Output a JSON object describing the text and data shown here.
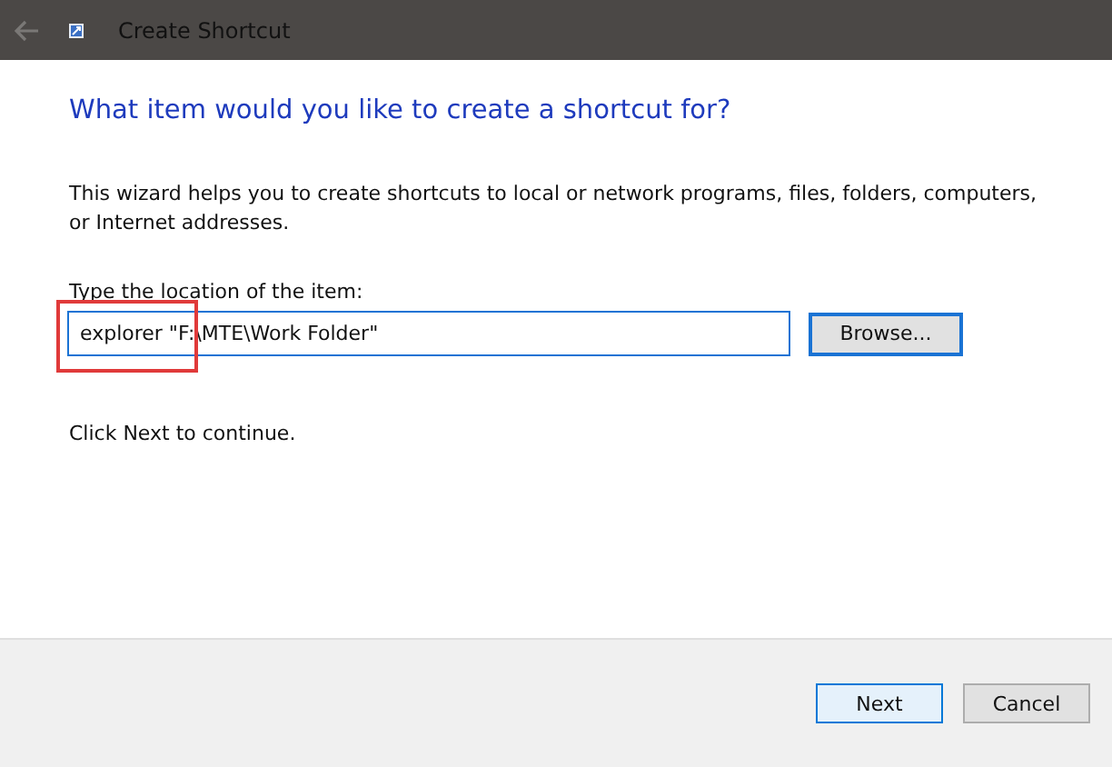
{
  "window": {
    "title": "Create Shortcut"
  },
  "heading": "What item would you like to create a shortcut for?",
  "description": "This wizard helps you to create shortcuts to local or network programs, files, folders, computers, or Internet addresses.",
  "location": {
    "label": "Type the location of the item:",
    "value": "explorer \"F:\\MTE\\Work Folder\"",
    "focused": true
  },
  "browse_button": "Browse...",
  "hint": "Click Next to continue.",
  "buttons": [
    {
      "label": "Next",
      "default": true
    },
    {
      "label": "Cancel",
      "default": false
    }
  ]
}
